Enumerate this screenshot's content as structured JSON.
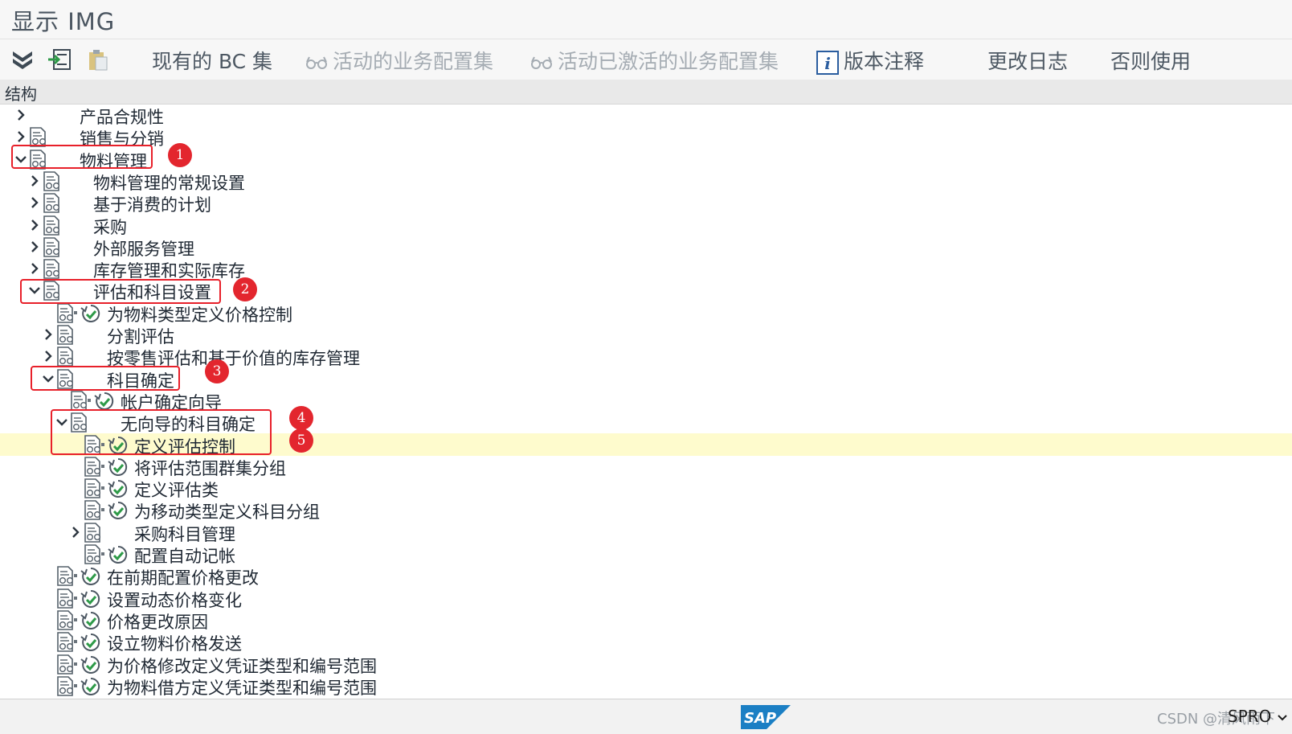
{
  "window": {
    "title": "显示 IMG"
  },
  "toolbar": {
    "buttons": [
      {
        "label": "现有的 BC 集",
        "enabled": true
      },
      {
        "label": "活动的业务配置集",
        "enabled": false
      },
      {
        "label": "活动已激活的业务配置集",
        "enabled": false
      },
      {
        "label": "版本注释",
        "enabled": true
      },
      {
        "label": "更改日志",
        "enabled": true
      },
      {
        "label": "否则使用",
        "enabled": true
      }
    ]
  },
  "structure": {
    "header": "结构"
  },
  "tree": {
    "rows": [
      {
        "label": "产品合规性",
        "level": 0,
        "toggle": "collapsed",
        "doc": false,
        "exec": false
      },
      {
        "label": "销售与分销",
        "level": 0,
        "toggle": "collapsed",
        "doc": true,
        "exec": false
      },
      {
        "label": "物料管理",
        "level": 0,
        "toggle": "expanded",
        "doc": true,
        "exec": false
      },
      {
        "label": "物料管理的常规设置",
        "level": 1,
        "toggle": "collapsed",
        "doc": true,
        "exec": false
      },
      {
        "label": "基于消费的计划",
        "level": 1,
        "toggle": "collapsed",
        "doc": true,
        "exec": false
      },
      {
        "label": "采购",
        "level": 1,
        "toggle": "collapsed",
        "doc": true,
        "exec": false
      },
      {
        "label": "外部服务管理",
        "level": 1,
        "toggle": "collapsed",
        "doc": true,
        "exec": false
      },
      {
        "label": "库存管理和实际库存",
        "level": 1,
        "toggle": "collapsed",
        "doc": true,
        "exec": false
      },
      {
        "label": "评估和科目设置",
        "level": 1,
        "toggle": "expanded",
        "doc": true,
        "exec": false
      },
      {
        "label": "为物料类型定义价格控制",
        "level": 2,
        "toggle": "leaf",
        "doc": true,
        "exec": true
      },
      {
        "label": "分割评估",
        "level": 2,
        "toggle": "collapsed",
        "doc": true,
        "exec": false
      },
      {
        "label": "按零售评估和基于价值的库存管理",
        "level": 2,
        "toggle": "collapsed",
        "doc": true,
        "exec": false
      },
      {
        "label": "科目确定",
        "level": 2,
        "toggle": "expanded",
        "doc": true,
        "exec": false
      },
      {
        "label": "帐户确定向导",
        "level": 3,
        "toggle": "leaf",
        "doc": true,
        "exec": true
      },
      {
        "label": "无向导的科目确定",
        "level": 3,
        "toggle": "expanded",
        "doc": true,
        "exec": false
      },
      {
        "label": "定义评估控制",
        "level": 4,
        "toggle": "leaf",
        "doc": true,
        "exec": true,
        "selected": true
      },
      {
        "label": "将评估范围群集分组",
        "level": 4,
        "toggle": "leaf",
        "doc": true,
        "exec": true
      },
      {
        "label": "定义评估类",
        "level": 4,
        "toggle": "leaf",
        "doc": true,
        "exec": true
      },
      {
        "label": "为移动类型定义科目分组",
        "level": 4,
        "toggle": "leaf",
        "doc": true,
        "exec": true
      },
      {
        "label": "采购科目管理",
        "level": 4,
        "toggle": "collapsed",
        "doc": true,
        "exec": false
      },
      {
        "label": "配置自动记帐",
        "level": 4,
        "toggle": "leaf",
        "doc": true,
        "exec": true
      },
      {
        "label": "在前期配置价格更改",
        "level": 2,
        "toggle": "leaf",
        "doc": true,
        "exec": true
      },
      {
        "label": "设置动态价格变化",
        "level": 2,
        "toggle": "leaf",
        "doc": true,
        "exec": true
      },
      {
        "label": "价格更改原因",
        "level": 2,
        "toggle": "leaf",
        "doc": true,
        "exec": true
      },
      {
        "label": "设立物料价格发送",
        "level": 2,
        "toggle": "leaf",
        "doc": true,
        "exec": true
      },
      {
        "label": "为价格修改定义凭证类型和编号范围",
        "level": 2,
        "toggle": "leaf",
        "doc": true,
        "exec": true
      },
      {
        "label": "为物料借方定义凭证类型和编号范围",
        "level": 2,
        "toggle": "leaf",
        "doc": true,
        "exec": true
      }
    ]
  },
  "annotations": [
    "1",
    "2",
    "3",
    "4",
    "5"
  ],
  "status": {
    "watermark": "CSDN @清风雨下",
    "tcode": "SPRO"
  },
  "colors": {
    "annotation_red": "#e3262e",
    "selection_yellow": "#fefbcd",
    "exec_green": "#2e9a48"
  }
}
